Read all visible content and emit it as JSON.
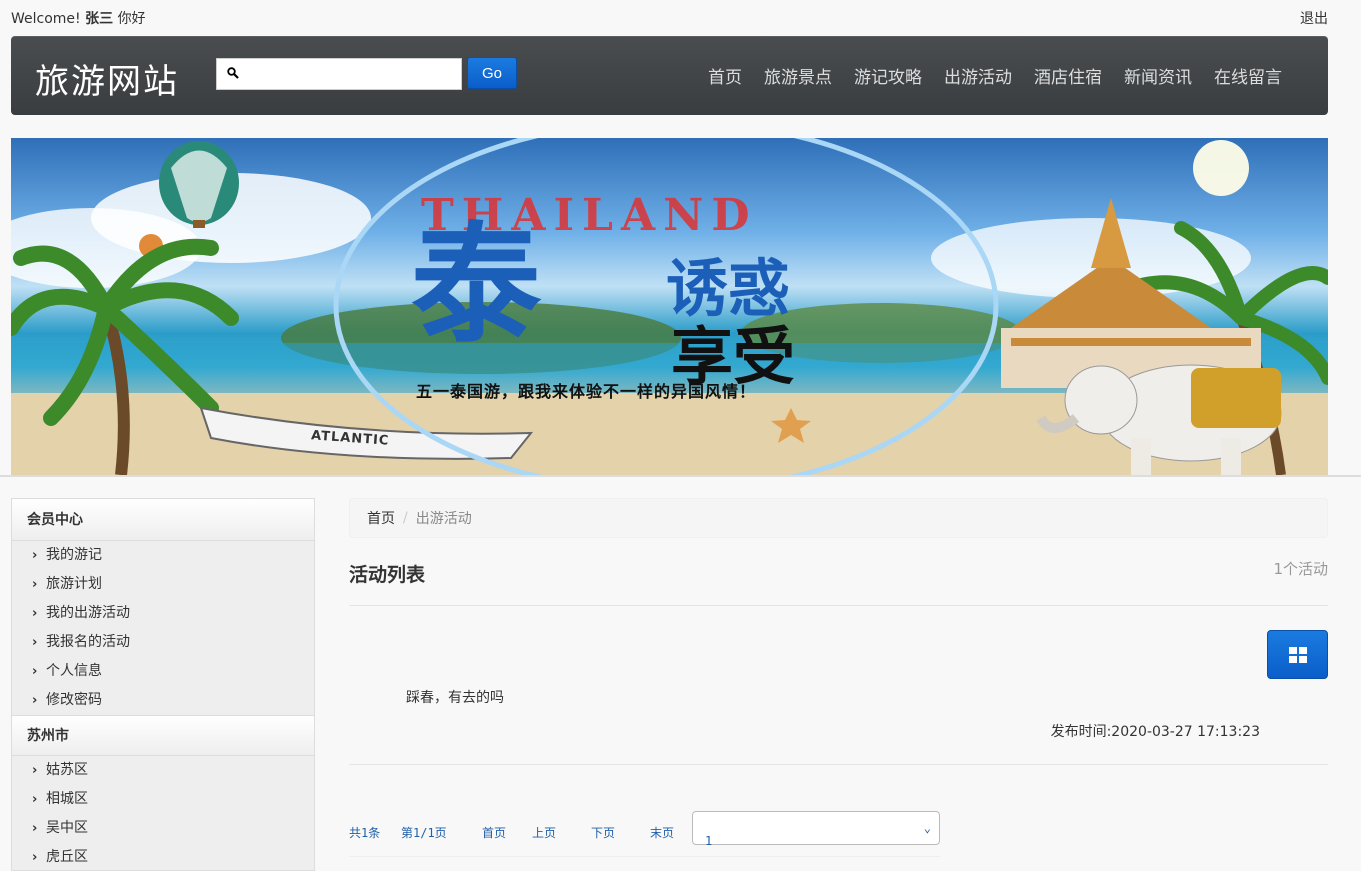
{
  "topbar": {
    "welcome_prefix": "Welcome!",
    "username": "张三",
    "greeting": "你好",
    "logout_label": "退出"
  },
  "header": {
    "brand": "旅游网站",
    "search": {
      "value": "",
      "placeholder": ""
    },
    "go_label": "Go",
    "nav": [
      {
        "label": "首页"
      },
      {
        "label": "旅游景点"
      },
      {
        "label": "游记攻略"
      },
      {
        "label": "出游活动"
      },
      {
        "label": "酒店住宿"
      },
      {
        "label": "新闻资讯"
      },
      {
        "label": "在线留言"
      }
    ]
  },
  "banner": {
    "word": "THAILAND",
    "big_char": "泰",
    "line1": "诱惑",
    "line2": "享受",
    "caption": "五一泰国游，跟我来体验不一样的异国风情！",
    "boat_text": "ATLANTIC"
  },
  "sidebar": {
    "member_title": "会员中心",
    "member_items": [
      {
        "label": "我的游记"
      },
      {
        "label": "旅游计划"
      },
      {
        "label": "我的出游活动"
      },
      {
        "label": "我报名的活动"
      },
      {
        "label": "个人信息"
      },
      {
        "label": "修改密码"
      }
    ],
    "city_title": "苏州市",
    "city_items": [
      {
        "label": "姑苏区"
      },
      {
        "label": "相城区"
      },
      {
        "label": "吴中区"
      },
      {
        "label": "虎丘区"
      }
    ]
  },
  "main": {
    "breadcrumb": {
      "home": "首页",
      "separator": "/",
      "current": "出游活动"
    },
    "list_title": "活动列表",
    "list_count": "1个活动",
    "activities": [
      {
        "text": "踩春，有去的吗",
        "time": "发布时间:2020-03-27 17:13:23"
      }
    ],
    "pager": {
      "total": "共1条",
      "page_info": "第1/1页",
      "first": "首页",
      "prev": "上页",
      "next": "下页",
      "last": "末页",
      "selected": "1"
    }
  },
  "colors": {
    "navbar": "#3f4245",
    "primary_button": "#0b5ec9",
    "link": "#1f5fa8"
  }
}
